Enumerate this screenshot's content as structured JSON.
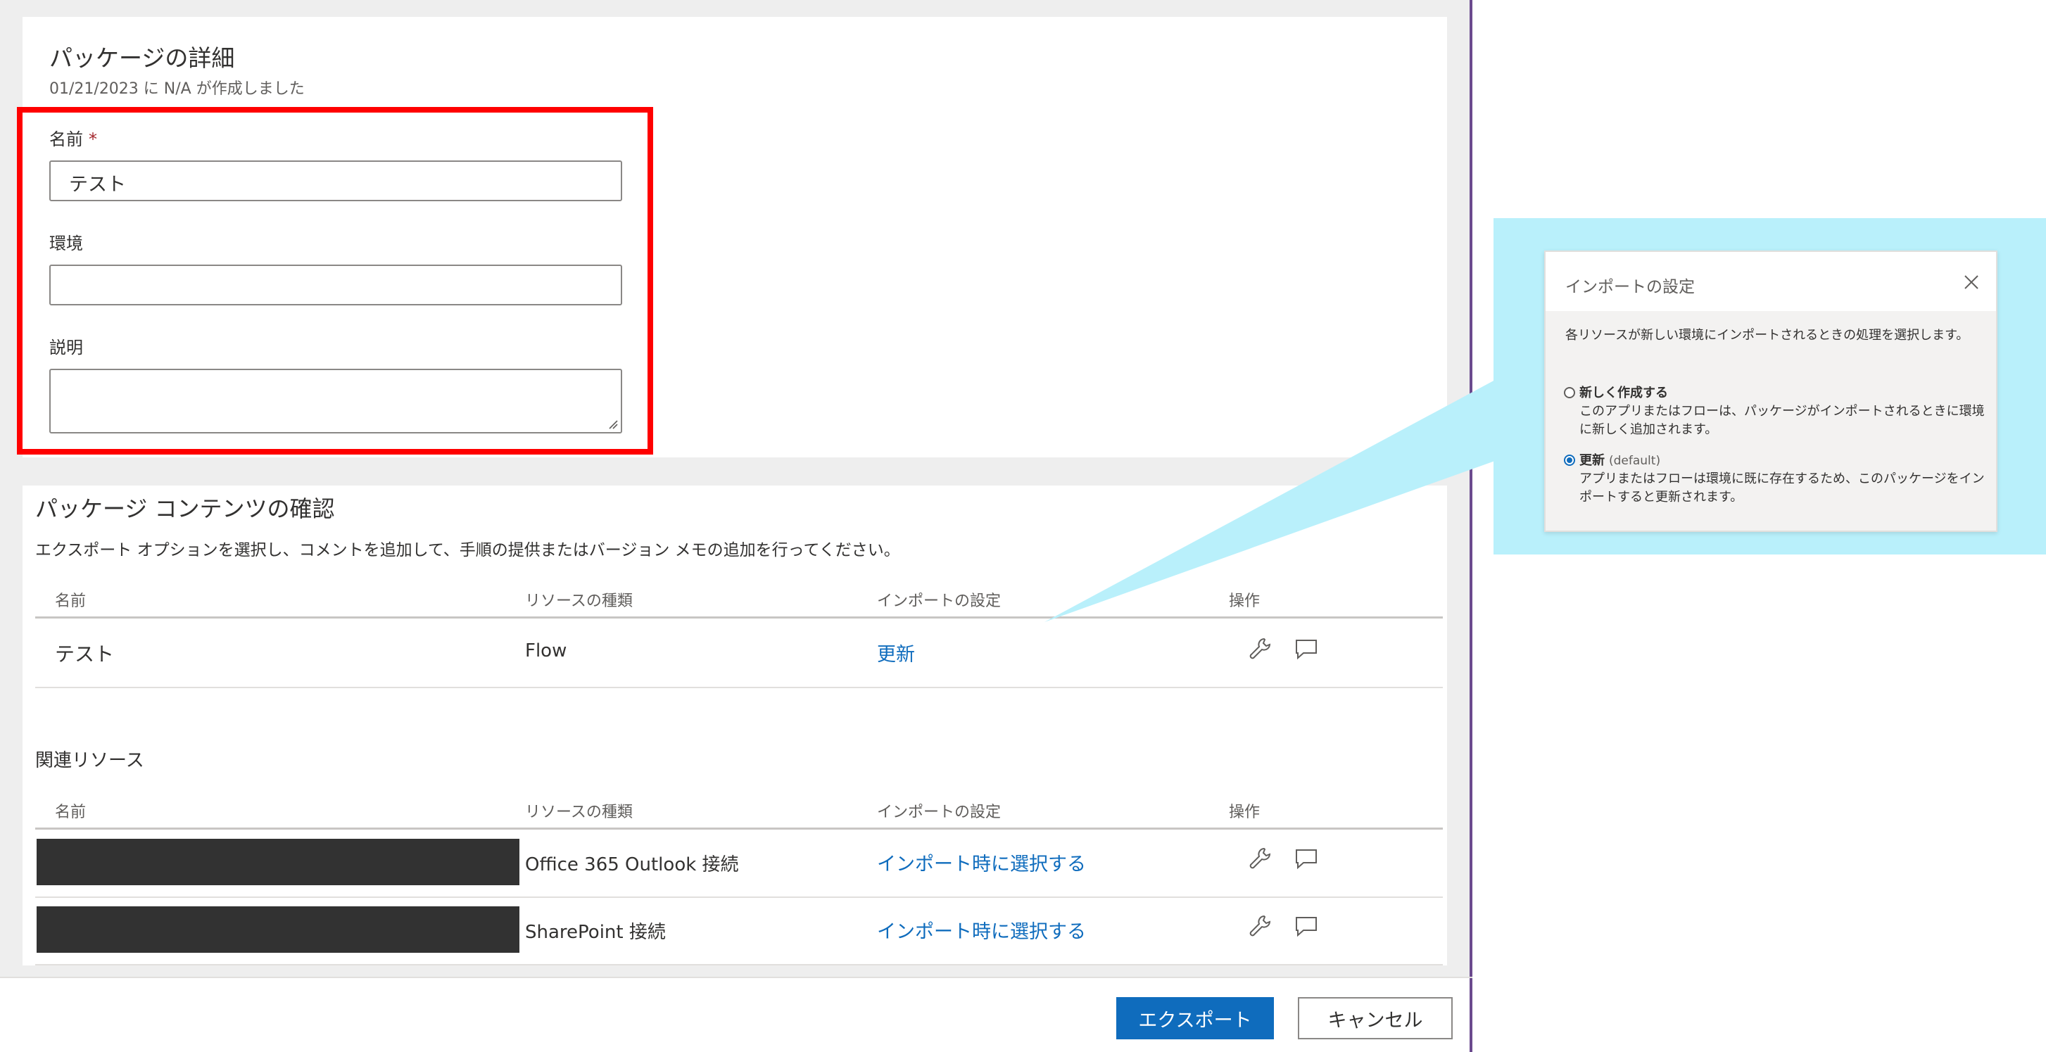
{
  "details": {
    "title": "パッケージの詳細",
    "subtitle": "01/21/2023 に N/A が作成しました",
    "name_label": "名前",
    "required_mark": "*",
    "name_value": "テスト",
    "environment_label": "環境",
    "environment_value": "",
    "description_label": "説明",
    "description_value": ""
  },
  "contents": {
    "title": "パッケージ コンテンツの確認",
    "instructions": "エクスポート オプションを選択し、コメントを追加して、手順の提供またはバージョン メモの追加を行ってください。",
    "columns": {
      "name": "名前",
      "resource_type": "リソースの種類",
      "import_setting": "インポートの設定",
      "actions": "操作"
    },
    "rows": [
      {
        "name": "テスト",
        "resource_type": "Flow",
        "import_setting": "更新"
      }
    ],
    "related_title": "関連リソース",
    "related_rows": [
      {
        "resource_type": "Office 365 Outlook 接続",
        "import_setting": "インポート時に選択する"
      },
      {
        "resource_type": "SharePoint 接続",
        "import_setting": "インポート時に選択する"
      }
    ]
  },
  "footer": {
    "export_label": "エクスポート",
    "cancel_label": "キャンセル"
  },
  "popup": {
    "title": "インポートの設定",
    "description": "各リソースが新しい環境にインポートされるときの処理を選択します。",
    "options": [
      {
        "label": "新しく作成する",
        "default_tag": "",
        "description": "このアプリまたはフローは、パッケージがインポートされるときに環境に新しく追加されます。",
        "selected": false
      },
      {
        "label": "更新",
        "default_tag": "(default)",
        "description": "アプリまたはフローは環境に既に存在するため、このパッケージをインポートすると更新されます。",
        "selected": true
      }
    ]
  },
  "colors": {
    "accent": "#0f6cbd",
    "highlight_frame": "#ff0000",
    "callout": "#b9f0fb"
  }
}
